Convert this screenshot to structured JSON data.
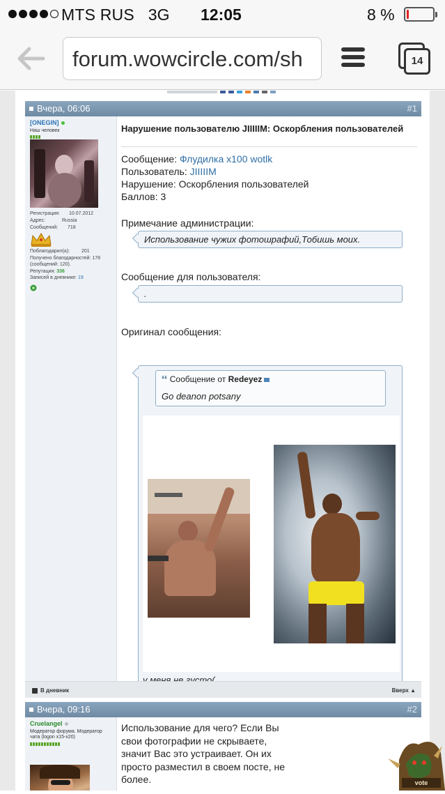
{
  "status_bar": {
    "carrier": "MTS RUS",
    "network": "3G",
    "time": "12:05",
    "battery": "8 %",
    "battery_level": 0.08
  },
  "browser": {
    "url": "forum.wowcircle.com/sh",
    "tab_count": "14"
  },
  "posts": [
    {
      "date": "Вчера, 06:06",
      "number": "#1",
      "user": {
        "name": "[ONEGIN]",
        "rank": "Наш человек",
        "reg_label": "Регистрация:",
        "reg_value": "10.07.2012",
        "addr_label": "Адрес:",
        "addr_value": "Russia",
        "msgs_label": "Сообщений:",
        "msgs_value": "718",
        "thanked_label": "Поблагодарил(а):",
        "thanked_value": "201",
        "received_label": "Получено благодарностей:",
        "received_value": "178",
        "received_note": "(сообщений: 120).",
        "rep_label": "Репутация:",
        "rep_value": "336",
        "diary_label": "Записей в дневнике:",
        "diary_value": "19"
      },
      "title": "Нарушение пользователю JIIIIIM: Оскорбления пользователей",
      "message_label": "Сообщение:",
      "message_link": "Флудилка x100 wotlk",
      "user_label": "Пользователь:",
      "user_link": "JIIIIIM",
      "violation_label": "Нарушение:",
      "violation_value": "Оскорбления пользователей",
      "points_label": "Баллов:",
      "points_value": "3",
      "admin_note_label": "Примечание администрации:",
      "admin_note": "Использование чужих фотошрафий,Тобишь моих.",
      "user_msg_label": "Сообщение для пользователя:",
      "user_msg": ".",
      "original_label": "Оригинал сообщения:",
      "quote_prefix": "Сообщение от",
      "quote_author": "Redeyez",
      "quote_text": "Go deanon potsany",
      "original_sign": "у меня не густо(",
      "footer_left": "В дневник",
      "footer_right": "Вверх ▲"
    },
    {
      "date": "Вчера, 09:16",
      "number": "#2",
      "user": {
        "name": "Cruelangel",
        "rank": "Модератор форума. Модератор чата (logon x15-x20)"
      },
      "text": "Использование для чего? Если Вы свои фотографии не скрываете, значит Вас это устраивает. Он их просто разместил в своем посте, не более."
    }
  ],
  "colors": {
    "header_bar": "#7f9ab3",
    "link": "#2f6fa6",
    "box_border": "#8eadc8",
    "battery_low": "#e32222"
  }
}
